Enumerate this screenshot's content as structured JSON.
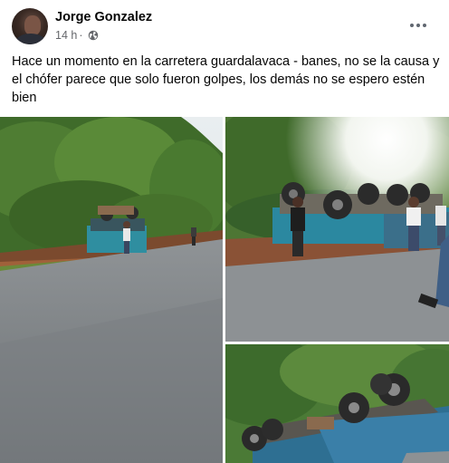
{
  "post": {
    "author": "Jorge Gonzalez",
    "time": "14 h",
    "separator": "·",
    "privacy_icon": "globe-icon",
    "more_icon": "more-options-icon",
    "text": "Hace un momento en la carretera guardalavaca - banes, no se la causa y el chófer parece que solo fueron golpes, los demás no se espero estén bien"
  },
  "photos": [
    {
      "name": "photo-1",
      "description_icon": "overturned-truck-roadside"
    },
    {
      "name": "photo-2",
      "description_icon": "overturned-truck-closeup"
    },
    {
      "name": "photo-3",
      "description_icon": "overturned-truck-wheels"
    }
  ]
}
